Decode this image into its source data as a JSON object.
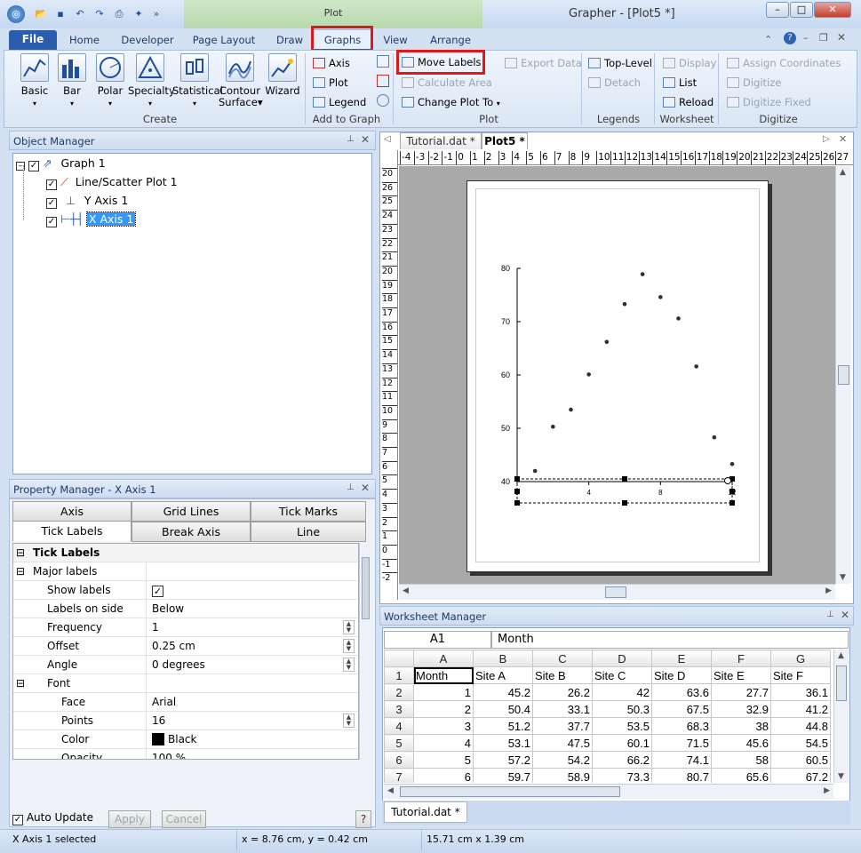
{
  "window": {
    "title": "Grapher - [Plot5 *]",
    "context_tab": "Plot",
    "buttons": {
      "minimize": "–",
      "maximize": "□",
      "close": "✕"
    }
  },
  "ribbon": {
    "tabs": [
      "File",
      "Home",
      "Developer",
      "Page Layout",
      "Draw",
      "Graphs",
      "View",
      "Arrange"
    ],
    "active_tab": "Graphs",
    "groups": {
      "create": {
        "label": "Create",
        "buttons": [
          "Basic",
          "Bar",
          "Polar",
          "Specialty",
          "Statistical",
          "Contour Surface",
          "Wizard"
        ]
      },
      "add_to_graph": {
        "label": "Add to Graph",
        "items": [
          "Axis",
          "Plot",
          "Legend"
        ]
      },
      "plot": {
        "label": "Plot",
        "items": [
          "Move Labels",
          "Calculate Area",
          "Change Plot To",
          "Export Data"
        ]
      },
      "legends": {
        "label": "Legends",
        "items": [
          "Top-Level",
          "Detach"
        ]
      },
      "worksheet": {
        "label": "Worksheet",
        "items": [
          "Display",
          "List",
          "Reload"
        ]
      },
      "digitize": {
        "label": "Digitize",
        "items": [
          "Assign Coordinates",
          "Digitize",
          "Digitize Fixed"
        ]
      }
    }
  },
  "object_manager": {
    "title": "Object Manager",
    "items": [
      {
        "label": "Graph 1",
        "level": 0
      },
      {
        "label": "Line/Scatter Plot 1",
        "level": 1
      },
      {
        "label": "Y Axis 1",
        "level": 1
      },
      {
        "label": "X Axis 1",
        "level": 1,
        "selected": true
      }
    ]
  },
  "property_manager": {
    "title": "Property Manager - X Axis 1",
    "tabs_row1": [
      "Axis",
      "Grid Lines",
      "Tick Marks"
    ],
    "tabs_row2": [
      "Tick Labels",
      "Break Axis",
      "Line"
    ],
    "active_tab": "Tick Labels",
    "section": "Tick Labels",
    "subsection": "Major labels",
    "rows": [
      {
        "key": "Show labels",
        "value": "✓",
        "type": "check"
      },
      {
        "key": "Labels on side",
        "value": "Below"
      },
      {
        "key": "Frequency",
        "value": "1",
        "spin": true
      },
      {
        "key": "Offset",
        "value": "0.25 cm",
        "spin": true
      },
      {
        "key": "Angle",
        "value": "0 degrees",
        "spin": true
      }
    ],
    "font_section": "Font",
    "font_rows": [
      {
        "key": "Face",
        "value": "Arial"
      },
      {
        "key": "Points",
        "value": "16",
        "spin": true
      },
      {
        "key": "Color",
        "value": "Black",
        "swatch": "#000000"
      },
      {
        "key": "Opacity",
        "value": "100 %"
      }
    ],
    "auto_update": "Auto Update",
    "apply": "Apply",
    "cancel": "Cancel",
    "help": "?"
  },
  "document_tabs": [
    "Tutorial.dat *",
    "Plot5 *"
  ],
  "active_document": "Plot5 *",
  "ruler": {
    "h_labels": [
      "-4",
      "-3",
      "-2",
      "-1",
      "0",
      "1",
      "2",
      "3",
      "4",
      "5",
      "6",
      "7",
      "8",
      "9",
      "10",
      "11",
      "12",
      "13",
      "14",
      "15",
      "16",
      "17",
      "18",
      "19",
      "20",
      "21",
      "22",
      "23",
      "24",
      "25",
      "26",
      "27"
    ],
    "v_labels": [
      "20",
      "26",
      "25",
      "24",
      "23",
      "22",
      "21",
      "20",
      "19",
      "18",
      "17",
      "16",
      "15",
      "14",
      "13",
      "12",
      "11",
      "10",
      "9",
      "8",
      "7",
      "6",
      "5",
      "4",
      "3",
      "2",
      "1",
      "0",
      "-1",
      "-2"
    ]
  },
  "chart_data": {
    "type": "scatter",
    "x": [
      1,
      2,
      3,
      4,
      5,
      6,
      7,
      8,
      9,
      10,
      11,
      12
    ],
    "y": [
      42,
      50.3,
      53.5,
      60.1,
      66.2,
      73.3,
      78.9,
      74.6,
      70.6,
      61.6,
      48.3,
      43.3
    ],
    "xlim": [
      0,
      12
    ],
    "ylim": [
      40,
      80
    ],
    "yticks": [
      40,
      50,
      60,
      70,
      80
    ],
    "xticks": [
      0,
      4,
      8,
      12
    ],
    "marker_color": "#1f3a1f",
    "grid": false
  },
  "worksheet": {
    "title": "Worksheet Manager",
    "cell_ref": "A1",
    "cell_value": "Month",
    "columns": [
      "A",
      "B",
      "C",
      "D",
      "E",
      "F",
      "G"
    ],
    "header_row": [
      "Month",
      "Site A",
      "Site B",
      "Site C",
      "Site D",
      "Site E",
      "Site F"
    ],
    "rows": [
      [
        "1",
        "45.2",
        "26.2",
        "42",
        "63.6",
        "27.7",
        "36.1"
      ],
      [
        "2",
        "50.4",
        "33.1",
        "50.3",
        "67.5",
        "32.9",
        "41.2"
      ],
      [
        "3",
        "51.2",
        "37.7",
        "53.5",
        "68.3",
        "38",
        "44.8"
      ],
      [
        "4",
        "53.1",
        "47.5",
        "60.1",
        "71.5",
        "45.6",
        "54.5"
      ],
      [
        "5",
        "57.2",
        "54.2",
        "66.2",
        "74.1",
        "58",
        "60.5"
      ],
      [
        "6",
        "59.7",
        "58.9",
        "73.3",
        "80.7",
        "65.6",
        "67.2"
      ]
    ],
    "sheet_tab": "Tutorial.dat *"
  },
  "status": {
    "left": "X Axis 1 selected",
    "coords": "x = 8.76 cm, y = 0.42 cm",
    "size": "15.71 cm x 1.39 cm"
  }
}
